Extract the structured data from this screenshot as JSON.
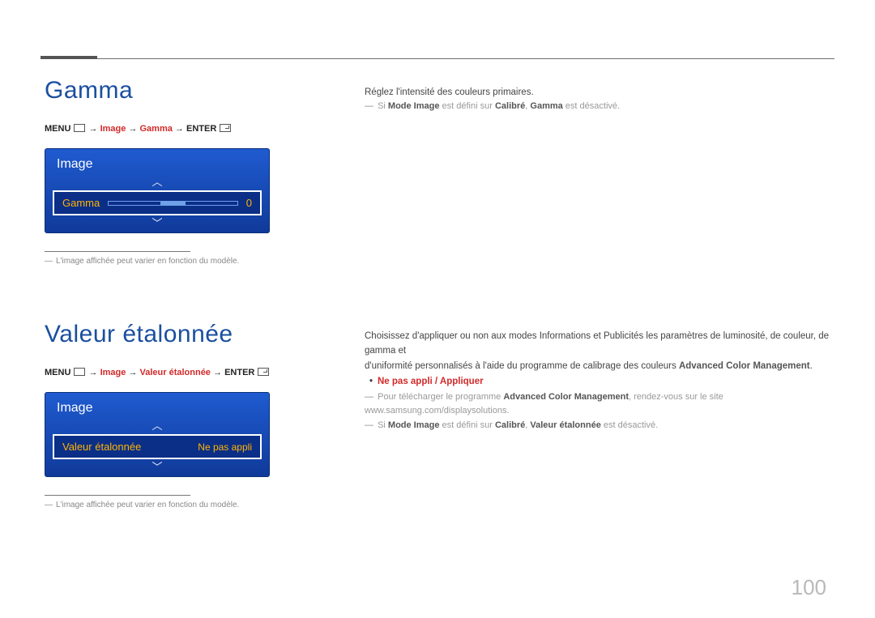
{
  "page_number": "100",
  "sections": [
    {
      "title": "Gamma",
      "path_prefix": "MENU",
      "path_img": "Image",
      "path_mid": "Gamma",
      "path_enter": "ENTER",
      "widget_title": "Image",
      "item_label": "Gamma",
      "item_value": "0",
      "footnote": "L'image affichée peut varier en fonction du modèle.",
      "desc_intro": "Réglez l'intensité des couleurs primaires.",
      "note_prefix": "Si ",
      "note_b1": "Mode Image",
      "note_mid": " est défini sur ",
      "note_b2": "Calibré",
      "note_afterb2": ", ",
      "note_b3": "Gamma",
      "note_suffix": " est désactivé."
    },
    {
      "title": "Valeur étalonnée",
      "path_prefix": "MENU",
      "path_img": "Image",
      "path_mid": "Valeur étalonnée",
      "path_enter": "ENTER",
      "widget_title": "Image",
      "item_label": "Valeur étalonnée",
      "item_value": "Ne pas appli",
      "footnote": "L'image affichée peut varier en fonction du modèle.",
      "desc_line1_a": "Choisissez d'appliquer ou non aux modes Informations et Publicités les paramètres de luminosité, de couleur, de gamma et",
      "desc_line1_b_pre": "d'uniformité personnalisés à l'aide du programme de calibrage des couleurs ",
      "desc_line1_b_bold": "Advanced Color Management",
      "desc_line1_b_post": ".",
      "bullet": "Ne pas appli / Appliquer",
      "note2_pre": "Pour télécharger le programme ",
      "note2_bold": "Advanced Color Management",
      "note2_post": ", rendez-vous sur le site www.samsung.com/displaysolutions.",
      "note3_prefix": "Si ",
      "note3_b1": "Mode Image",
      "note3_mid": " est défini sur ",
      "note3_b2": "Calibré",
      "note3_afterb2": ", ",
      "note3_b3": "Valeur étalonnée",
      "note3_suffix": " est désactivé."
    }
  ]
}
